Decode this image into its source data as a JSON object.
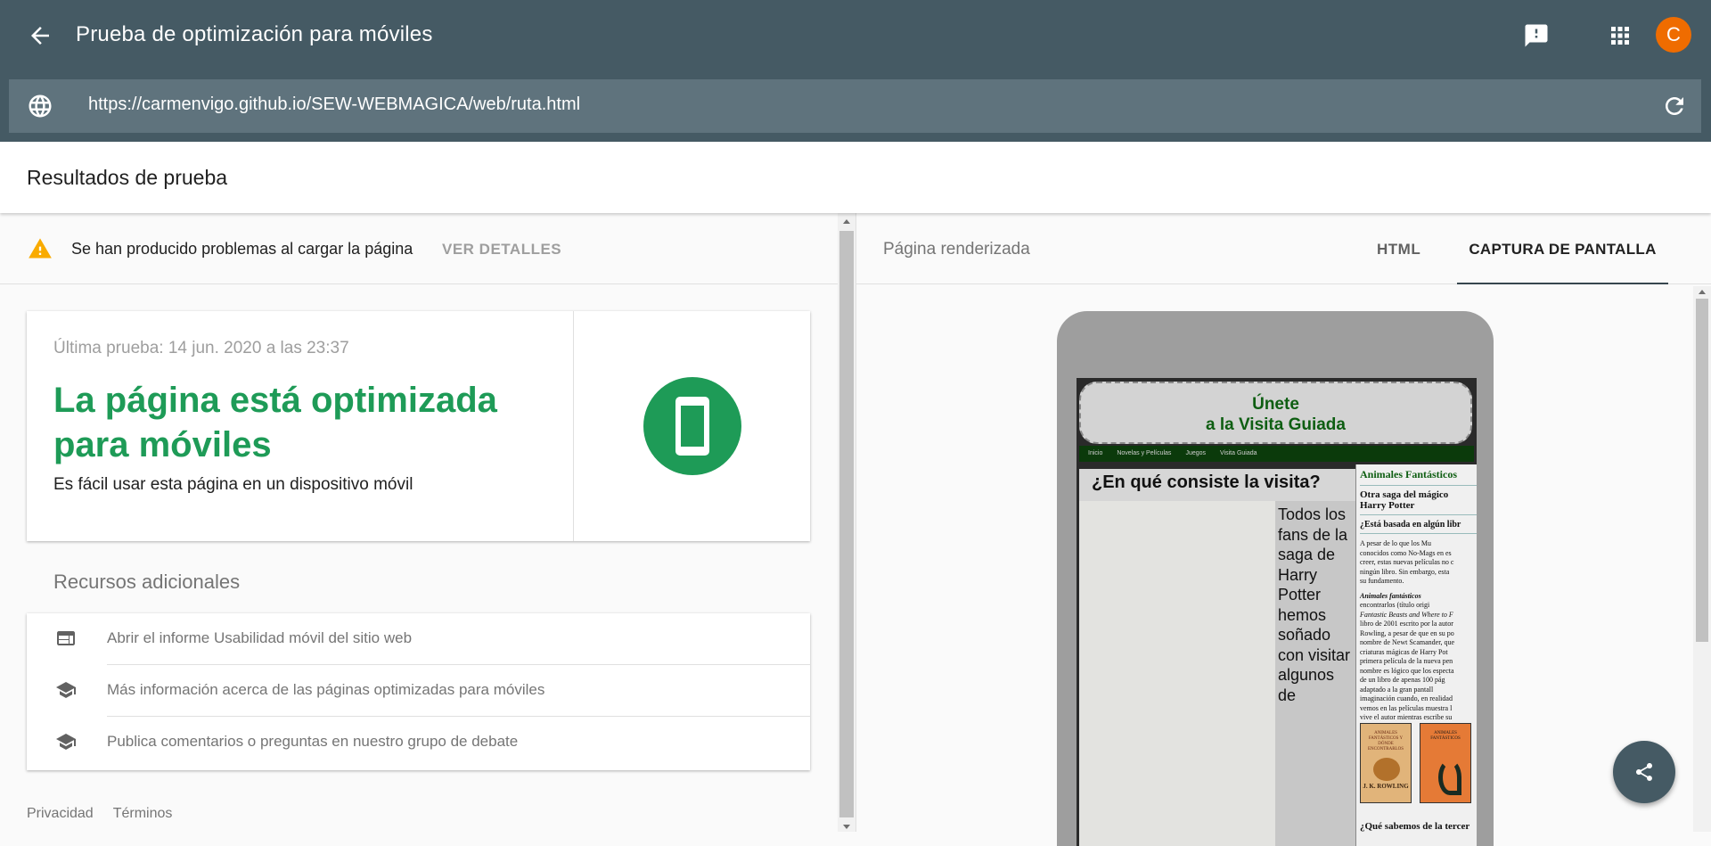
{
  "header": {
    "title": "Prueba de optimización para móviles",
    "avatar_letter": "C",
    "avatar_color": "#ef6c00",
    "bar_color": "#455a64",
    "url": "https://carmenvigo.github.io/SEW-WEBMAGICA/web/ruta.html"
  },
  "results": {
    "heading": "Resultados de prueba"
  },
  "warning": {
    "text": "Se han producido problemas al cargar la página",
    "link": "VER DETALLES"
  },
  "summary": {
    "date": "Última prueba: 14 jun. 2020 a las 23:37",
    "headline": "La página está optimizada para móviles",
    "subtitle": "Es fácil usar esta página en un dispositivo móvil",
    "accent": "#1e9b57"
  },
  "resources": {
    "title": "Recursos adicionales",
    "items": [
      {
        "label": "Abrir el informe Usabilidad móvil del sitio web",
        "icon": "web-report-icon"
      },
      {
        "label": "Más información acerca de las páginas optimizadas para móviles",
        "icon": "school-icon"
      },
      {
        "label": "Publica comentarios o preguntas en nuestro grupo de debate",
        "icon": "school-icon"
      }
    ]
  },
  "footer": {
    "privacy": "Privacidad",
    "terms": "Términos"
  },
  "preview": {
    "title": "Página renderizada",
    "tabs": [
      "HTML",
      "CAPTURA DE PANTALLA"
    ],
    "active_tab": "CAPTURA DE PANTALLA",
    "site": {
      "header_line1": "Únete",
      "header_line2": "a la Visita Guiada",
      "nav": [
        "Inicio",
        "Novelas y Películas",
        "Juegos",
        "Visita Guiada"
      ],
      "main_heading": "¿En qué consiste la visita?",
      "main_text": "Todos los fans de la saga de Harry Potter hemos soñado con visitar algunos de",
      "side_title": "Animales Fantásticos",
      "side_heading": "Otra saga del mágico Harry Potter",
      "side_q1": "¿Está basada en algún libr",
      "side_p1_lines": [
        "A pesar de lo que los Mu",
        "conocidos como No-Mags en es",
        "creer, estas nuevas películas no c",
        "ningún libro. Sin embargo, esta",
        "su fundamento."
      ],
      "side_p2_lines": [
        "Animales     fantásticos",
        "encontrarlos  (título origi",
        "Fantastic Beasts and Where to F",
        "libro de 2001 escrito por la autor",
        "Rowling, a pesar de que en su po",
        "nombre de Newt Scamander, que",
        "criaturas mágicas de Harry Pot",
        "primera película de la nueva pen",
        "nombre es lógico que los especta",
        "de un libro de apenas 100 pág",
        "adaptado  a  la  gran  pantall",
        "imaginación cuando, en realidad",
        "vemos en las películas muestra l",
        "vive el autor mientras escribe su"
      ],
      "book1_title": "ANIMALES FANTÁSTICOS Y DÓNDE ENCONTRARLOS",
      "book1_author": "J. K. ROWLING",
      "book2_title": "ANIMALES FANTÁSTICOS",
      "side_q2": "¿Qué sabemos de la tercer"
    }
  }
}
